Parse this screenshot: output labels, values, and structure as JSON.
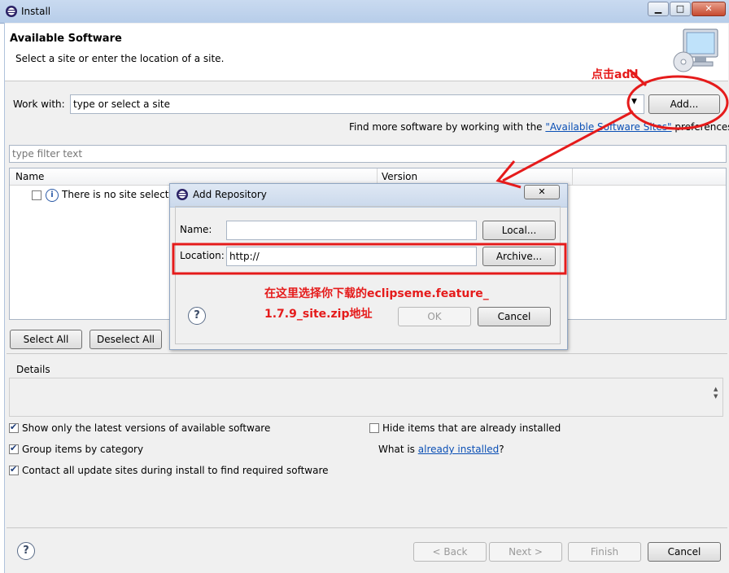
{
  "window": {
    "title": "Install",
    "minimize": "▁",
    "maximize": "□",
    "close": "✕"
  },
  "banner": {
    "title": "Available Software",
    "description": "Select a site or enter the location of a site."
  },
  "work_with": {
    "label": "Work with:",
    "value": "type or select a site",
    "add_label": "Add..."
  },
  "find_more": {
    "prefix": "Find more software by working with the ",
    "link": "\"Available Software Sites\"",
    "suffix": " preferences."
  },
  "filter": {
    "placeholder": "type filter text"
  },
  "table": {
    "columns": [
      "Name",
      "Version"
    ],
    "rows": [
      {
        "text": "There is no site selected."
      }
    ]
  },
  "selection": {
    "select_all": "Select All",
    "deselect_all": "Deselect All"
  },
  "details": {
    "label": "Details"
  },
  "options": {
    "latest_versions": "Show only the latest versions of available software",
    "group_by_category": "Group items by category",
    "contact_all": "Contact all update sites during install to find required software",
    "hide_installed": "Hide items that are already installed",
    "what_is_prefix": "What is ",
    "already_installed_link": "already installed",
    "what_is_suffix": "?"
  },
  "footer": {
    "back": "< Back",
    "next": "Next >",
    "finish": "Finish",
    "cancel": "Cancel"
  },
  "dialog": {
    "title": "Add Repository",
    "close": "✕",
    "name_label": "Name:",
    "name_value": "",
    "local_label": "Local...",
    "location_label": "Location:",
    "location_value": "http://",
    "archive_label": "Archive...",
    "ok": "OK",
    "cancel": "Cancel"
  },
  "annotations": {
    "click_add": "点击add",
    "location_note_line1": "在这里选择你下载的eclipseme.feature_",
    "location_note_line2": "1.7.9_site.zip地址",
    "color": "#e51b1b"
  }
}
